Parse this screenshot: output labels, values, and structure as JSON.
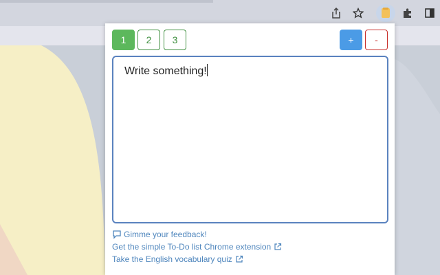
{
  "browser": {
    "toolbar": {
      "share_icon": "share-icon",
      "star_icon": "bookmark-star-icon",
      "extension_icon": "note-extension-icon",
      "puzzle_icon": "puzzle-extensions-icon",
      "sidepanel_icon": "side-panel-icon"
    }
  },
  "popup": {
    "tabs": [
      {
        "label": "1",
        "active": true
      },
      {
        "label": "2",
        "active": false
      },
      {
        "label": "3",
        "active": false
      }
    ],
    "add_label": "+",
    "remove_label": "-",
    "note_text": "Write something!",
    "links": [
      {
        "icon": "feedback-icon",
        "label": "Gimme your feedback!"
      },
      {
        "icon": "external-link-icon",
        "label": "Get the simple To-Do list Chrome extension"
      },
      {
        "icon": "external-link-icon",
        "label": "Take the English vocabulary quiz"
      }
    ]
  },
  "colors": {
    "tab_active_bg": "#5cb85c",
    "tab_border": "#3f8f3f",
    "add_button_bg": "#4b9be6",
    "remove_button_border": "#c9302c",
    "link_color": "#4f86bd",
    "textarea_border": "#5a82bf"
  }
}
